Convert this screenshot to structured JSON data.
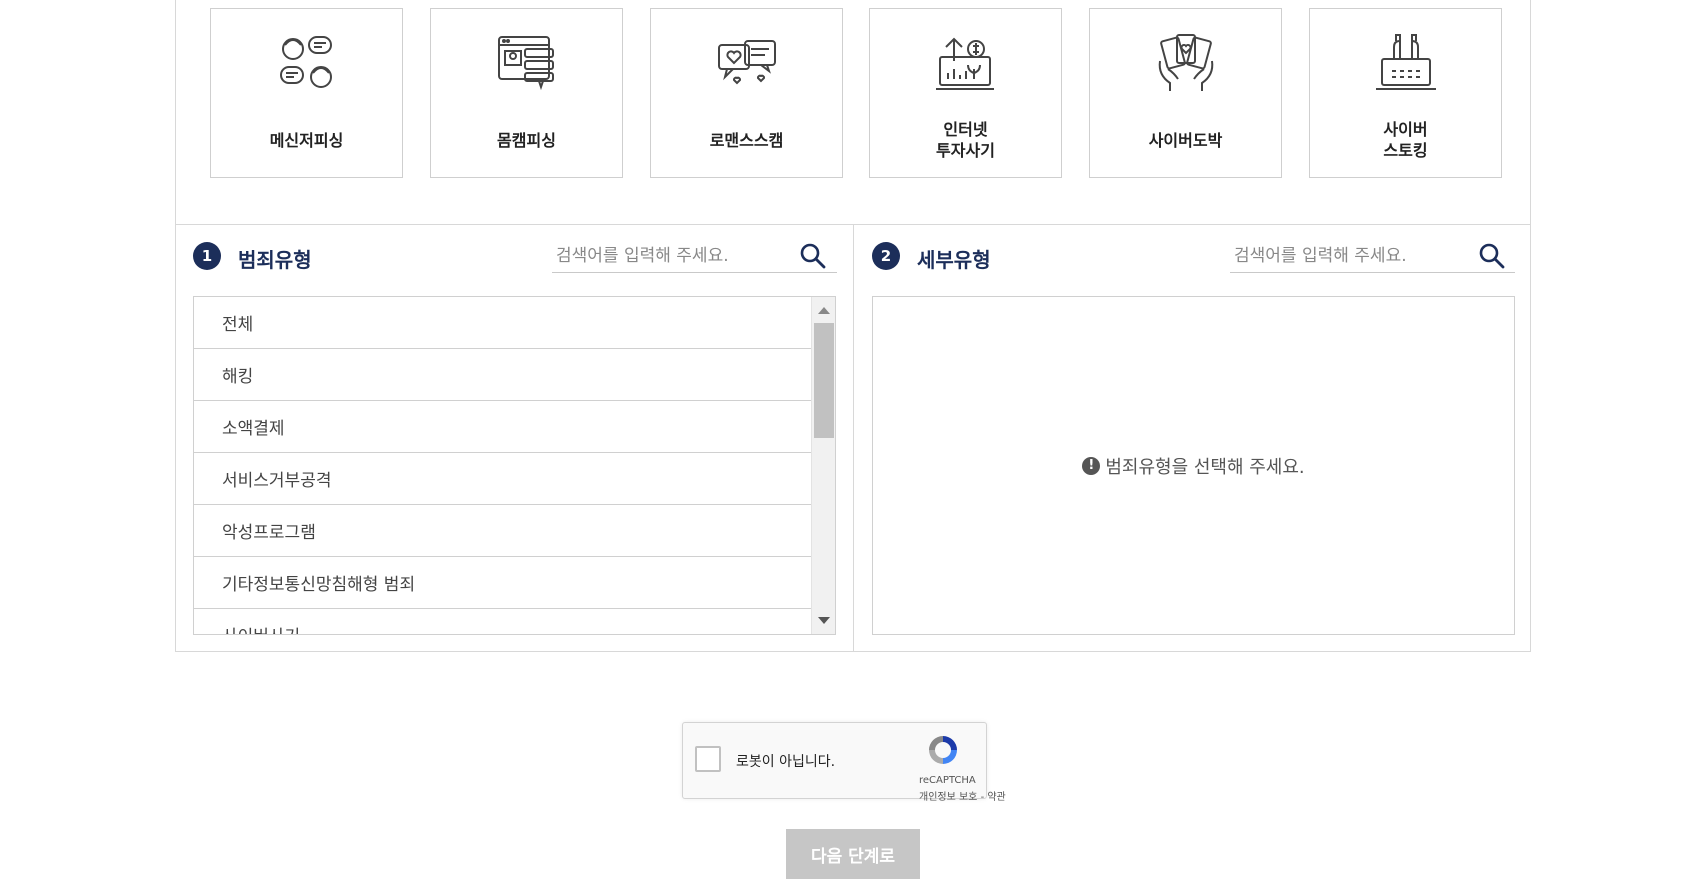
{
  "categories": [
    {
      "label": "메신저피싱",
      "icon": "messenger-phishing-icon"
    },
    {
      "label": "몸캠피싱",
      "icon": "webcam-phishing-icon"
    },
    {
      "label": "로맨스스캠",
      "icon": "romance-scam-icon"
    },
    {
      "label": "인터넷\n투자사기",
      "icon": "investment-fraud-icon"
    },
    {
      "label": "사이버도박",
      "icon": "cyber-gambling-icon"
    },
    {
      "label": "사이버\n스토킹",
      "icon": "cyber-stalking-icon"
    }
  ],
  "crime_type": {
    "step": "1",
    "title": "범죄유형",
    "search_placeholder": "검색어를 입력해 주세요.",
    "items": [
      "전체",
      "해킹",
      "소액결제",
      "서비스거부공격",
      "악성프로그램",
      "기타정보통신망침해형 범죄",
      "사이버사기"
    ]
  },
  "detail_type": {
    "step": "2",
    "title": "세부유형",
    "search_placeholder": "검색어를 입력해 주세요.",
    "empty_message": "범죄유형을 선택해 주세요."
  },
  "recaptcha": {
    "label": "로봇이 아닙니다.",
    "brand": "reCAPTCHA",
    "privacy": "개인정보 보호",
    "separator": " - ",
    "terms": "약관"
  },
  "next_button": "다음 단계로",
  "colors": {
    "accent": "#1c2e5a",
    "button_disabled": "#c6c6c6"
  }
}
